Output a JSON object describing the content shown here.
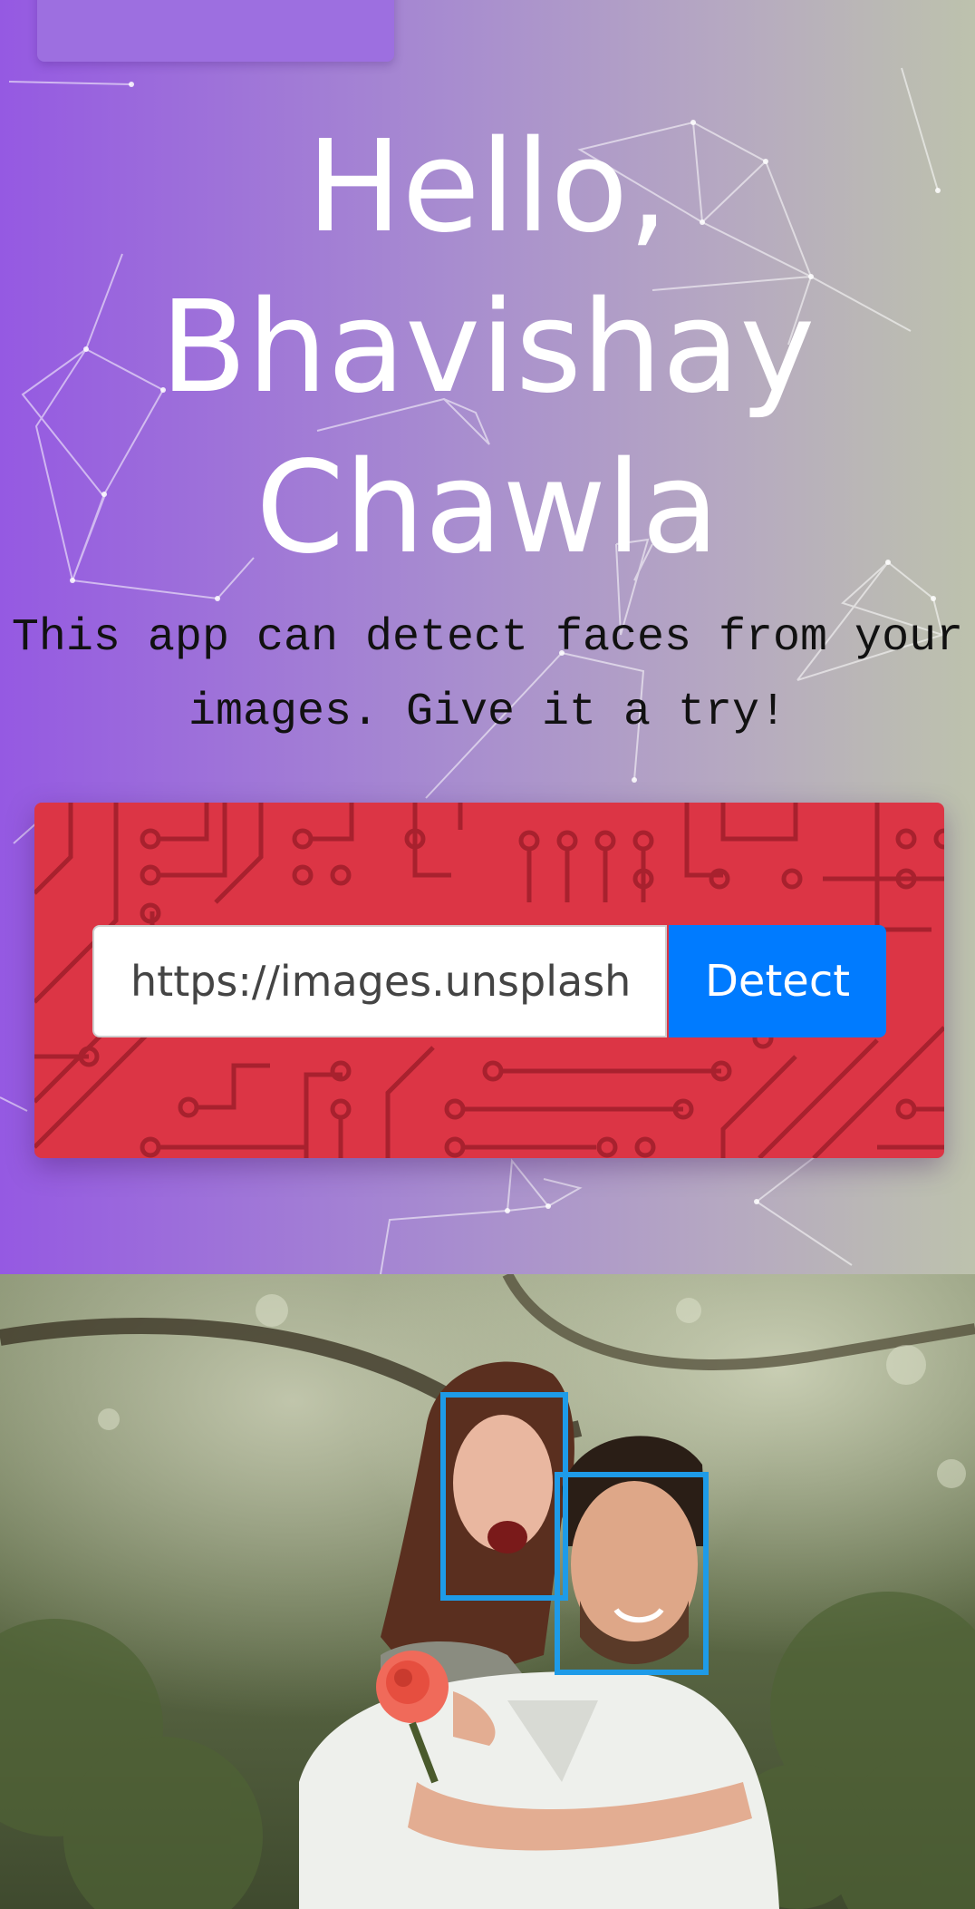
{
  "header": {
    "greeting": "Hello, Bhavishay Chawla",
    "tagline": "This app can detect faces from your images. Give it a try!"
  },
  "detect_form": {
    "url_value": "https://images.unsplash.com/photo",
    "button_label": "Detect"
  },
  "result": {
    "faces_detected": 2
  },
  "colors": {
    "gradient_start": "#9559e2",
    "gradient_end": "#bdc2ad",
    "card_red": "#dc3545",
    "button_blue": "#007bff",
    "face_box_blue": "#1e9be8"
  },
  "icons": {
    "logo": "logo-icon"
  }
}
